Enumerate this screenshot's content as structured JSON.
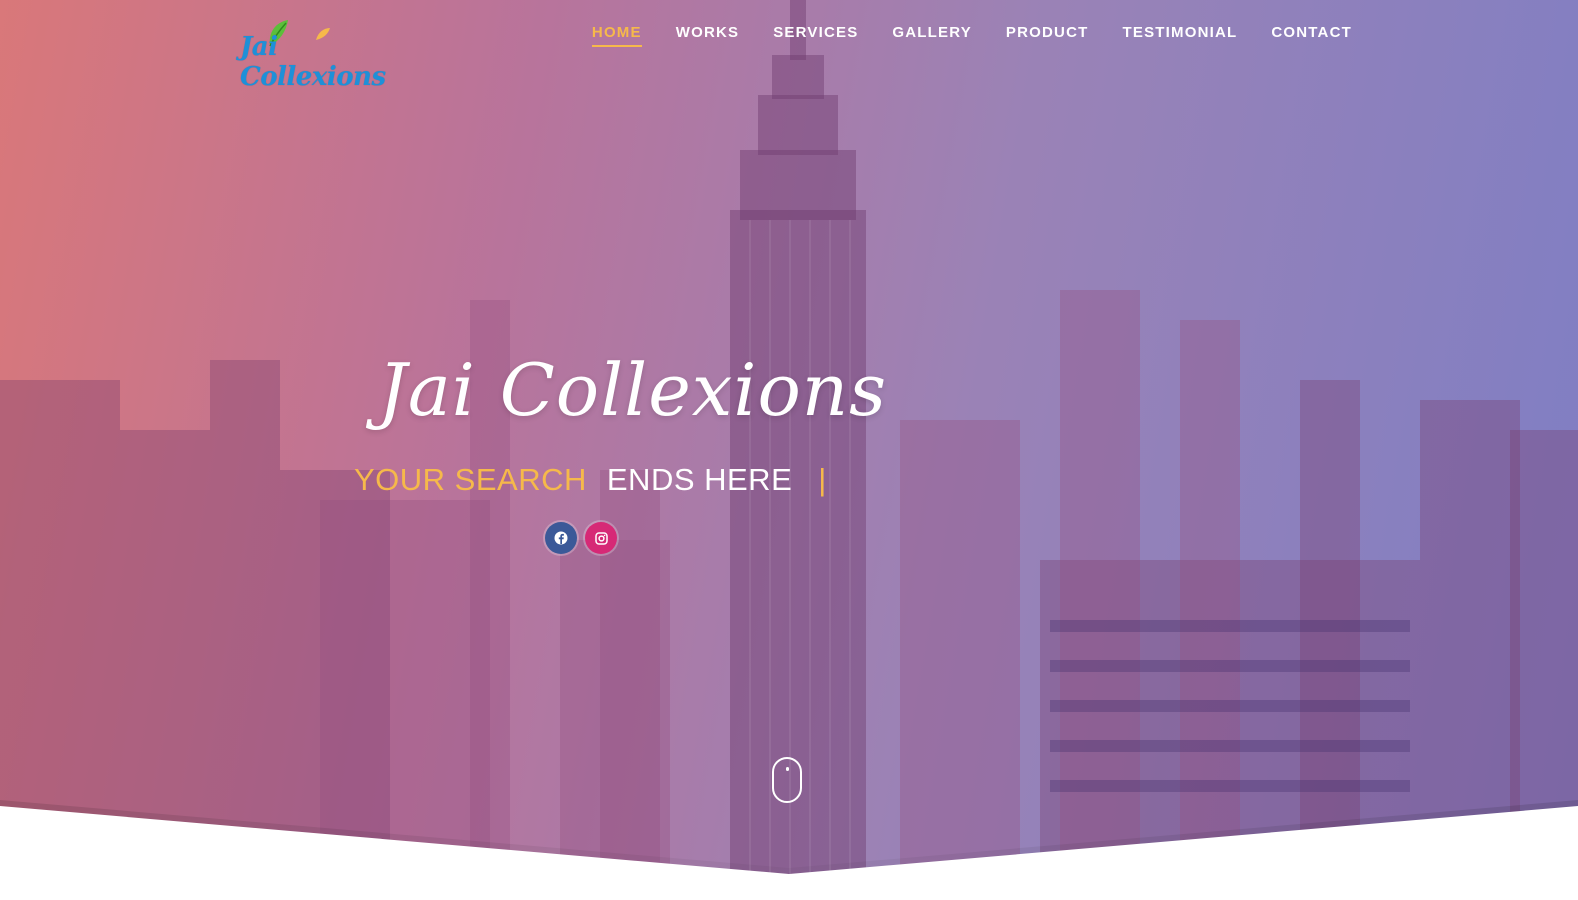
{
  "brand": {
    "logo_text": "Jai Collexions"
  },
  "nav": {
    "items": [
      {
        "label": "HOME",
        "active": true
      },
      {
        "label": "WORKS",
        "active": false
      },
      {
        "label": "SERVICES",
        "active": false
      },
      {
        "label": "GALLERY",
        "active": false
      },
      {
        "label": "PRODUCT",
        "active": false
      },
      {
        "label": "TESTIMONIAL",
        "active": false
      },
      {
        "label": "CONTACT",
        "active": false
      }
    ]
  },
  "hero": {
    "title": "Jai Collexions",
    "tagline_highlight": "YOUR SEARCH",
    "tagline_rest": "ENDS HERE",
    "tagline_cursor": "|"
  },
  "social": {
    "icons": [
      "facebook-icon",
      "instagram-icon"
    ]
  },
  "colors": {
    "accent": "#f6b94a",
    "logo_blue": "#1e90d8",
    "facebook": "#3b5998",
    "instagram": "#d62976"
  }
}
